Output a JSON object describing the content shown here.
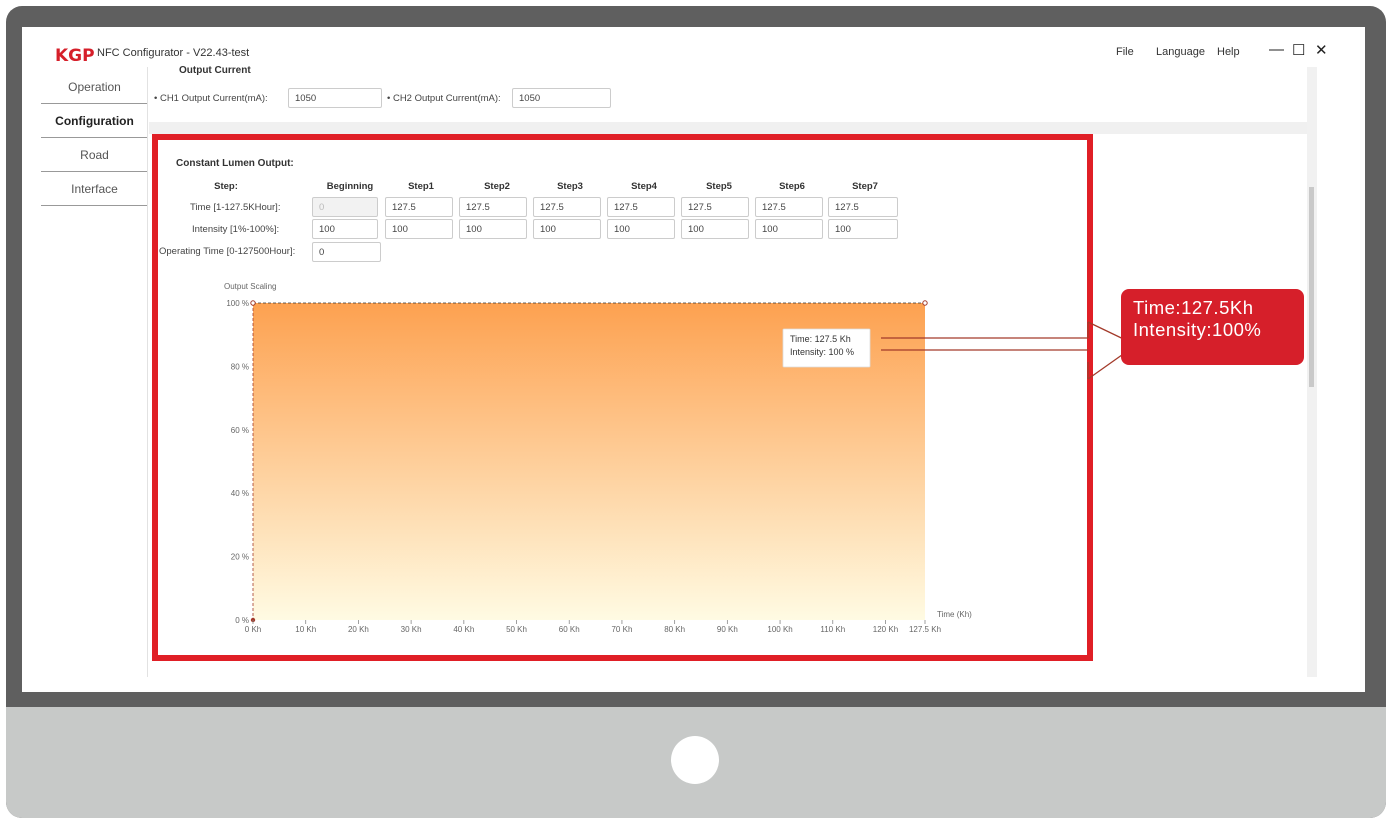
{
  "window": {
    "logo": "KGP",
    "title": "NFC Configurator - V22.43-test",
    "menu": [
      "File",
      "Language",
      "Help"
    ],
    "controls": [
      "—",
      "☐",
      "✕"
    ]
  },
  "nav": {
    "items": [
      {
        "label": "Operation",
        "active": false
      },
      {
        "label": "Configuration",
        "active": true
      },
      {
        "label": "Road",
        "active": false
      },
      {
        "label": "Interface",
        "active": false
      }
    ]
  },
  "output_current": {
    "title": "Output Current",
    "ch1_label": "• CH1 Output Current(mA):",
    "ch1_value": "1050",
    "ch2_label": "• CH2 Output Current(mA):",
    "ch2_value": "1050"
  },
  "clo": {
    "title": "Constant Lumen Output:",
    "step_label": "Step:",
    "headers": [
      "Beginning",
      "Step1",
      "Step2",
      "Step3",
      "Step4",
      "Step5",
      "Step6",
      "Step7"
    ],
    "time_label": "Time [1-127.5KHour]:",
    "time_values": [
      "0",
      "127.5",
      "127.5",
      "127.5",
      "127.5",
      "127.5",
      "127.5",
      "127.5"
    ],
    "intensity_label": "Intensity [1%-100%]:",
    "intensity_values": [
      "100",
      "100",
      "100",
      "100",
      "100",
      "100",
      "100",
      "100"
    ],
    "operating_label": "Operating Time [0-127500Hour]:",
    "operating_value": "0"
  },
  "chart_data": {
    "type": "area",
    "ylabel": "Output Scaling",
    "xlabel": "Time (Kh)",
    "x": [
      0,
      127.5
    ],
    "y": [
      100,
      100
    ],
    "xlim": [
      0,
      127.5
    ],
    "ylim": [
      0,
      100
    ],
    "x_ticks": [
      "0 Kh",
      "10 Kh",
      "20 Kh",
      "30 Kh",
      "40 Kh",
      "50 Kh",
      "60 Kh",
      "70 Kh",
      "80 Kh",
      "90 Kh",
      "100 Kh",
      "110 Kh",
      "120 Kh",
      "127.5 Kh"
    ],
    "x_tick_values": [
      0,
      10,
      20,
      30,
      40,
      50,
      60,
      70,
      80,
      90,
      100,
      110,
      120,
      127.5
    ],
    "y_ticks": [
      "0 %",
      "20 %",
      "40 %",
      "60 %",
      "80 %",
      "100 %"
    ],
    "y_tick_values": [
      0,
      20,
      40,
      60,
      80,
      100
    ],
    "tooltip": {
      "time": "Time: 127.5 Kh",
      "intensity": "Intensity: 100 %"
    },
    "grid": true,
    "colors": {
      "top": "#fda150",
      "bottom": "#fffbe3",
      "line": "#a33a2a"
    }
  },
  "callout": {
    "line1": "Time:127.5Kh",
    "line2": "Intensity:100%"
  },
  "colors": {
    "accent": "#e01f26",
    "bezel": "#5f5f5f",
    "stand": "#c7c9c8"
  }
}
